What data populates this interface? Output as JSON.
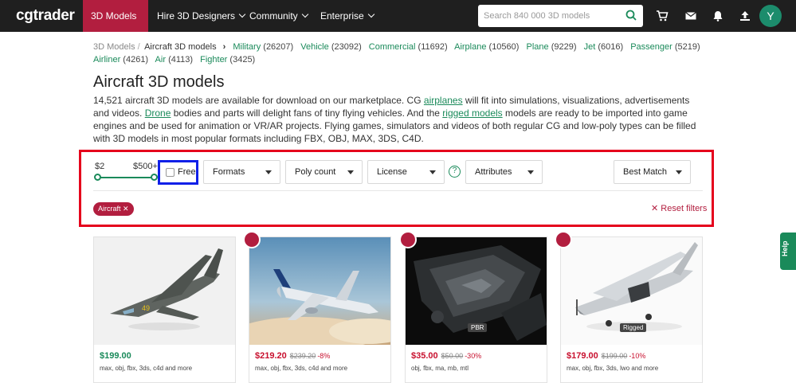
{
  "nav": {
    "logo": "cgtrader",
    "items": [
      {
        "label": "3D Models"
      },
      {
        "label": "Hire 3D Designers"
      },
      {
        "label": "Community"
      },
      {
        "label": "Enterprise"
      }
    ],
    "search_placeholder": "Search 840 000 3D models",
    "avatar_initial": "Y"
  },
  "breadcrumbs": {
    "root": "3D Models",
    "separator": "/",
    "current": "Aircraft 3D models",
    "subcategories": [
      {
        "label": "Military",
        "count": "(26207)"
      },
      {
        "label": "Vehicle",
        "count": "(23092)"
      },
      {
        "label": "Commercial",
        "count": "(11692)"
      },
      {
        "label": "Airplane",
        "count": "(10560)"
      },
      {
        "label": "Plane",
        "count": "(9229)"
      },
      {
        "label": "Jet",
        "count": "(6016)"
      },
      {
        "label": "Passenger",
        "count": "(5219)"
      },
      {
        "label": "Airliner",
        "count": "(4261)"
      },
      {
        "label": "Air",
        "count": "(4113)"
      },
      {
        "label": "Fighter",
        "count": "(3425)"
      }
    ]
  },
  "page": {
    "title": "Aircraft 3D models",
    "desc": {
      "p1": "14,521 aircraft 3D models are available for download on our marketplace. CG ",
      "link1": "airplanes",
      "p2": " will fit into simulations, visualizations, advertisements and videos. ",
      "link2": "Drone",
      "p3": " bodies and parts will delight fans of tiny flying vehicles. And the ",
      "link3": "rigged models",
      "p4": " models are ready to be imported into game engines and be used for animation or VR/AR projects. Flying games, simulators and videos of both regular CG and low-poly types can be filled with 3D models in most popular formats including FBX, OBJ, MAX, 3DS, C4D."
    }
  },
  "filters": {
    "price_min": "$2",
    "price_max": "$500+",
    "free_label": "Free",
    "formats": "Formats",
    "poly_count": "Poly count",
    "license": "License",
    "help": "?",
    "attributes": "Attributes",
    "sort": "Best Match",
    "active_chip": "Aircraft ✕",
    "reset": "✕ Reset filters"
  },
  "help_tab": "Help",
  "cards": [
    {
      "price": "$199.00",
      "old_price": "",
      "discount": "",
      "formats": "max, obj, fbx, 3ds, c4d and more",
      "badge": ""
    },
    {
      "price": "$219.20",
      "old_price": "$239.20",
      "discount": "-8%",
      "formats": "max, obj, fbx, 3ds, c4d and more",
      "badge": ""
    },
    {
      "price": "$35.00",
      "old_price": "$50.00",
      "discount": "-30%",
      "formats": "obj, fbx, ma, mb, mtl",
      "badge": "PBR"
    },
    {
      "price": "$179.00",
      "old_price": "$199.00",
      "discount": "-10%",
      "formats": "max, obj, fbx, 3ds, lwo and more",
      "badge": "Rigged"
    }
  ],
  "colors": {
    "brand_red": "#b21e3f",
    "accent_green": "#1a8a5a",
    "nav_bg": "#1f1f1f",
    "annotation_red": "#e5001c",
    "annotation_blue": "#1020e8"
  }
}
